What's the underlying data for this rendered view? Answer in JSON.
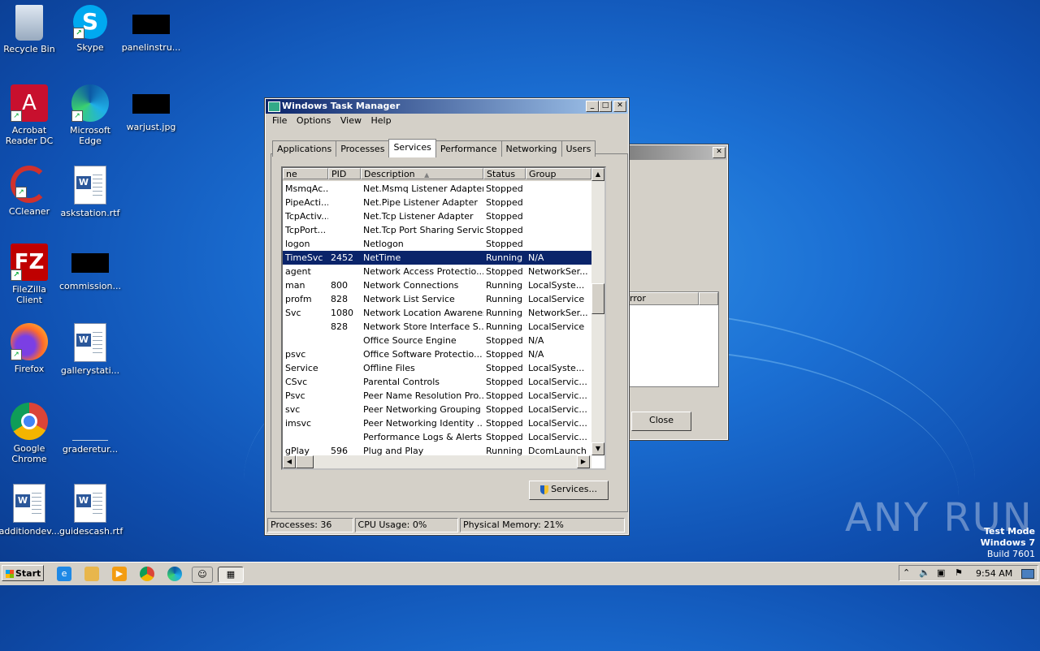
{
  "desktop": {
    "icons": [
      {
        "label": "Recycle Bin"
      },
      {
        "label": "Skype"
      },
      {
        "label": "panelinstru..."
      },
      {
        "label": "Acrobat Reader DC"
      },
      {
        "label": "Microsoft Edge"
      },
      {
        "label": "warjust.jpg"
      },
      {
        "label": "CCleaner"
      },
      {
        "label": "askstation.rtf"
      },
      {
        "label": "FileZilla Client"
      },
      {
        "label": "commission..."
      },
      {
        "label": "Firefox"
      },
      {
        "label": "gallerystati..."
      },
      {
        "label": "Google Chrome"
      },
      {
        "label": "graderetur..."
      },
      {
        "label": "additiondev..."
      },
      {
        "label": "guidescash.rtf"
      }
    ]
  },
  "task_manager": {
    "title": "Windows Task Manager",
    "menu": [
      "File",
      "Options",
      "View",
      "Help"
    ],
    "tabs": [
      "Applications",
      "Processes",
      "Services",
      "Performance",
      "Networking",
      "Users"
    ],
    "active_tab": "Services",
    "columns": [
      "ne",
      "PID",
      "Description",
      "Status",
      "Group"
    ],
    "rows": [
      [
        "MsmqAc...",
        "",
        "Net.Msmq Listener Adapter",
        "Stopped",
        ""
      ],
      [
        "PipeActi...",
        "",
        "Net.Pipe Listener Adapter",
        "Stopped",
        ""
      ],
      [
        "TcpActiv...",
        "",
        "Net.Tcp Listener Adapter",
        "Stopped",
        ""
      ],
      [
        "TcpPort...",
        "",
        "Net.Tcp Port Sharing Service",
        "Stopped",
        ""
      ],
      [
        "logon",
        "",
        "Netlogon",
        "Stopped",
        ""
      ],
      [
        "TimeSvc",
        "2452",
        "NetTime",
        "Running",
        "N/A"
      ],
      [
        "agent",
        "",
        "Network Access Protectio...",
        "Stopped",
        "NetworkSer..."
      ],
      [
        "man",
        "800",
        "Network Connections",
        "Running",
        "LocalSyste..."
      ],
      [
        "profm",
        "828",
        "Network List Service",
        "Running",
        "LocalService"
      ],
      [
        "Svc",
        "1080",
        "Network Location Awareness",
        "Running",
        "NetworkSer..."
      ],
      [
        "",
        "828",
        "Network Store Interface S...",
        "Running",
        "LocalService"
      ],
      [
        "",
        "",
        "Office  Source Engine",
        "Stopped",
        "N/A"
      ],
      [
        "psvc",
        "",
        "Office Software Protectio...",
        "Stopped",
        "N/A"
      ],
      [
        "Service",
        "",
        "Offline Files",
        "Stopped",
        "LocalSyste..."
      ],
      [
        "CSvc",
        "",
        "Parental Controls",
        "Stopped",
        "LocalServic..."
      ],
      [
        "Psvc",
        "",
        "Peer Name Resolution Pro...",
        "Stopped",
        "LocalServic..."
      ],
      [
        "svc",
        "",
        "Peer Networking Grouping",
        "Stopped",
        "LocalServic..."
      ],
      [
        "imsvc",
        "",
        "Peer Networking Identity ...",
        "Stopped",
        "LocalServic..."
      ],
      [
        "",
        "",
        "Performance Logs & Alerts",
        "Stopped",
        "LocalServic..."
      ],
      [
        "gPlay",
        "596",
        "Plug and Play",
        "Running",
        "DcomLaunch"
      ]
    ],
    "selected_row": 5,
    "services_button": "Services...",
    "status": {
      "processes": "Processes: 36",
      "cpu": "CPU Usage: 0%",
      "memory": "Physical Memory: 21%"
    }
  },
  "back_dialog": {
    "column": "rror",
    "close_button": "Close"
  },
  "taskbar": {
    "start": "Start",
    "clock": "9:54 AM"
  },
  "watermark": "ANY RUN",
  "testmode": {
    "line1": "Test Mode",
    "line2": "Windows 7",
    "line3": "Build 7601"
  }
}
